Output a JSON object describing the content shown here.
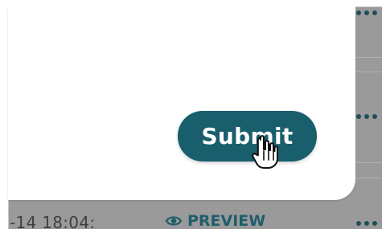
{
  "background": {
    "timestamp_text": "-14 18:04:",
    "preview_label": "PREVIEW"
  },
  "modal": {
    "submit_label": "Submit"
  },
  "colors": {
    "primary": "#195e6c",
    "overlay": "#9a9a9a",
    "surface": "#ffffff",
    "dots": "#1f4f59"
  },
  "icons": {
    "preview": "eye-icon",
    "more": "more-options-icon",
    "pointer": "hand-cursor-icon"
  }
}
